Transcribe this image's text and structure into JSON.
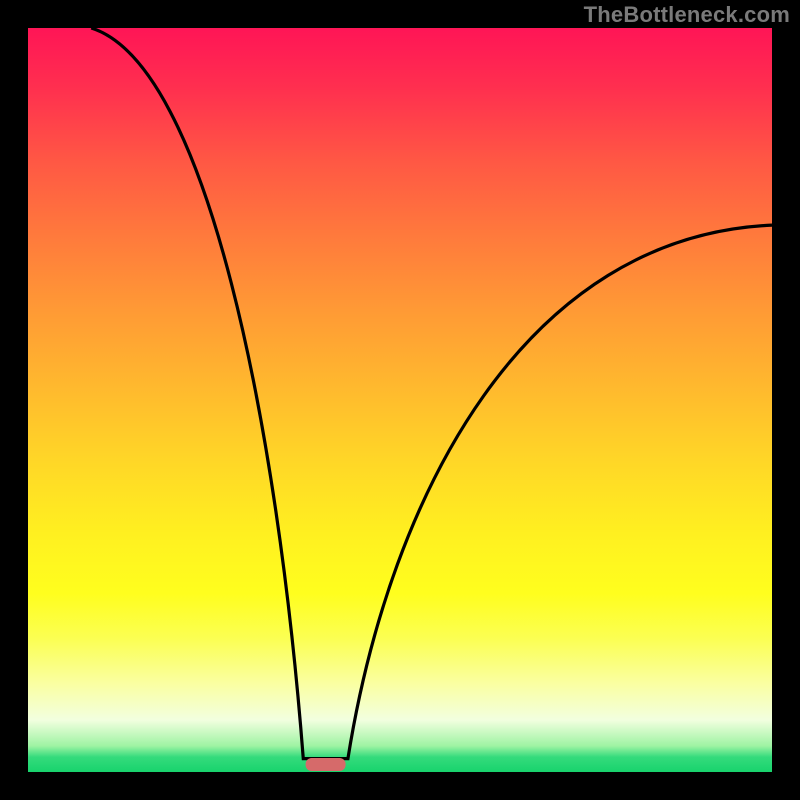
{
  "watermark": "TheBottleneck.com",
  "chart_data": {
    "type": "line",
    "title": "",
    "xlabel": "",
    "ylabel": "",
    "xlim": [
      0,
      1
    ],
    "ylim": [
      0,
      1
    ],
    "curve": {
      "minimum_x": 0.4,
      "left_start": {
        "x": 0.085,
        "y": 1.0
      },
      "right_end": {
        "x": 1.0,
        "y": 0.735
      },
      "shape": "v-curve (two steep branches meeting at a minimum near bottom)"
    },
    "marker": {
      "x": 0.4,
      "y": 0.002,
      "color": "#d66a6a",
      "shape": "rounded-bar"
    },
    "background_gradient": [
      "#ff1556",
      "#ffd627",
      "#18d36d"
    ],
    "grid": false,
    "legend": false
  }
}
